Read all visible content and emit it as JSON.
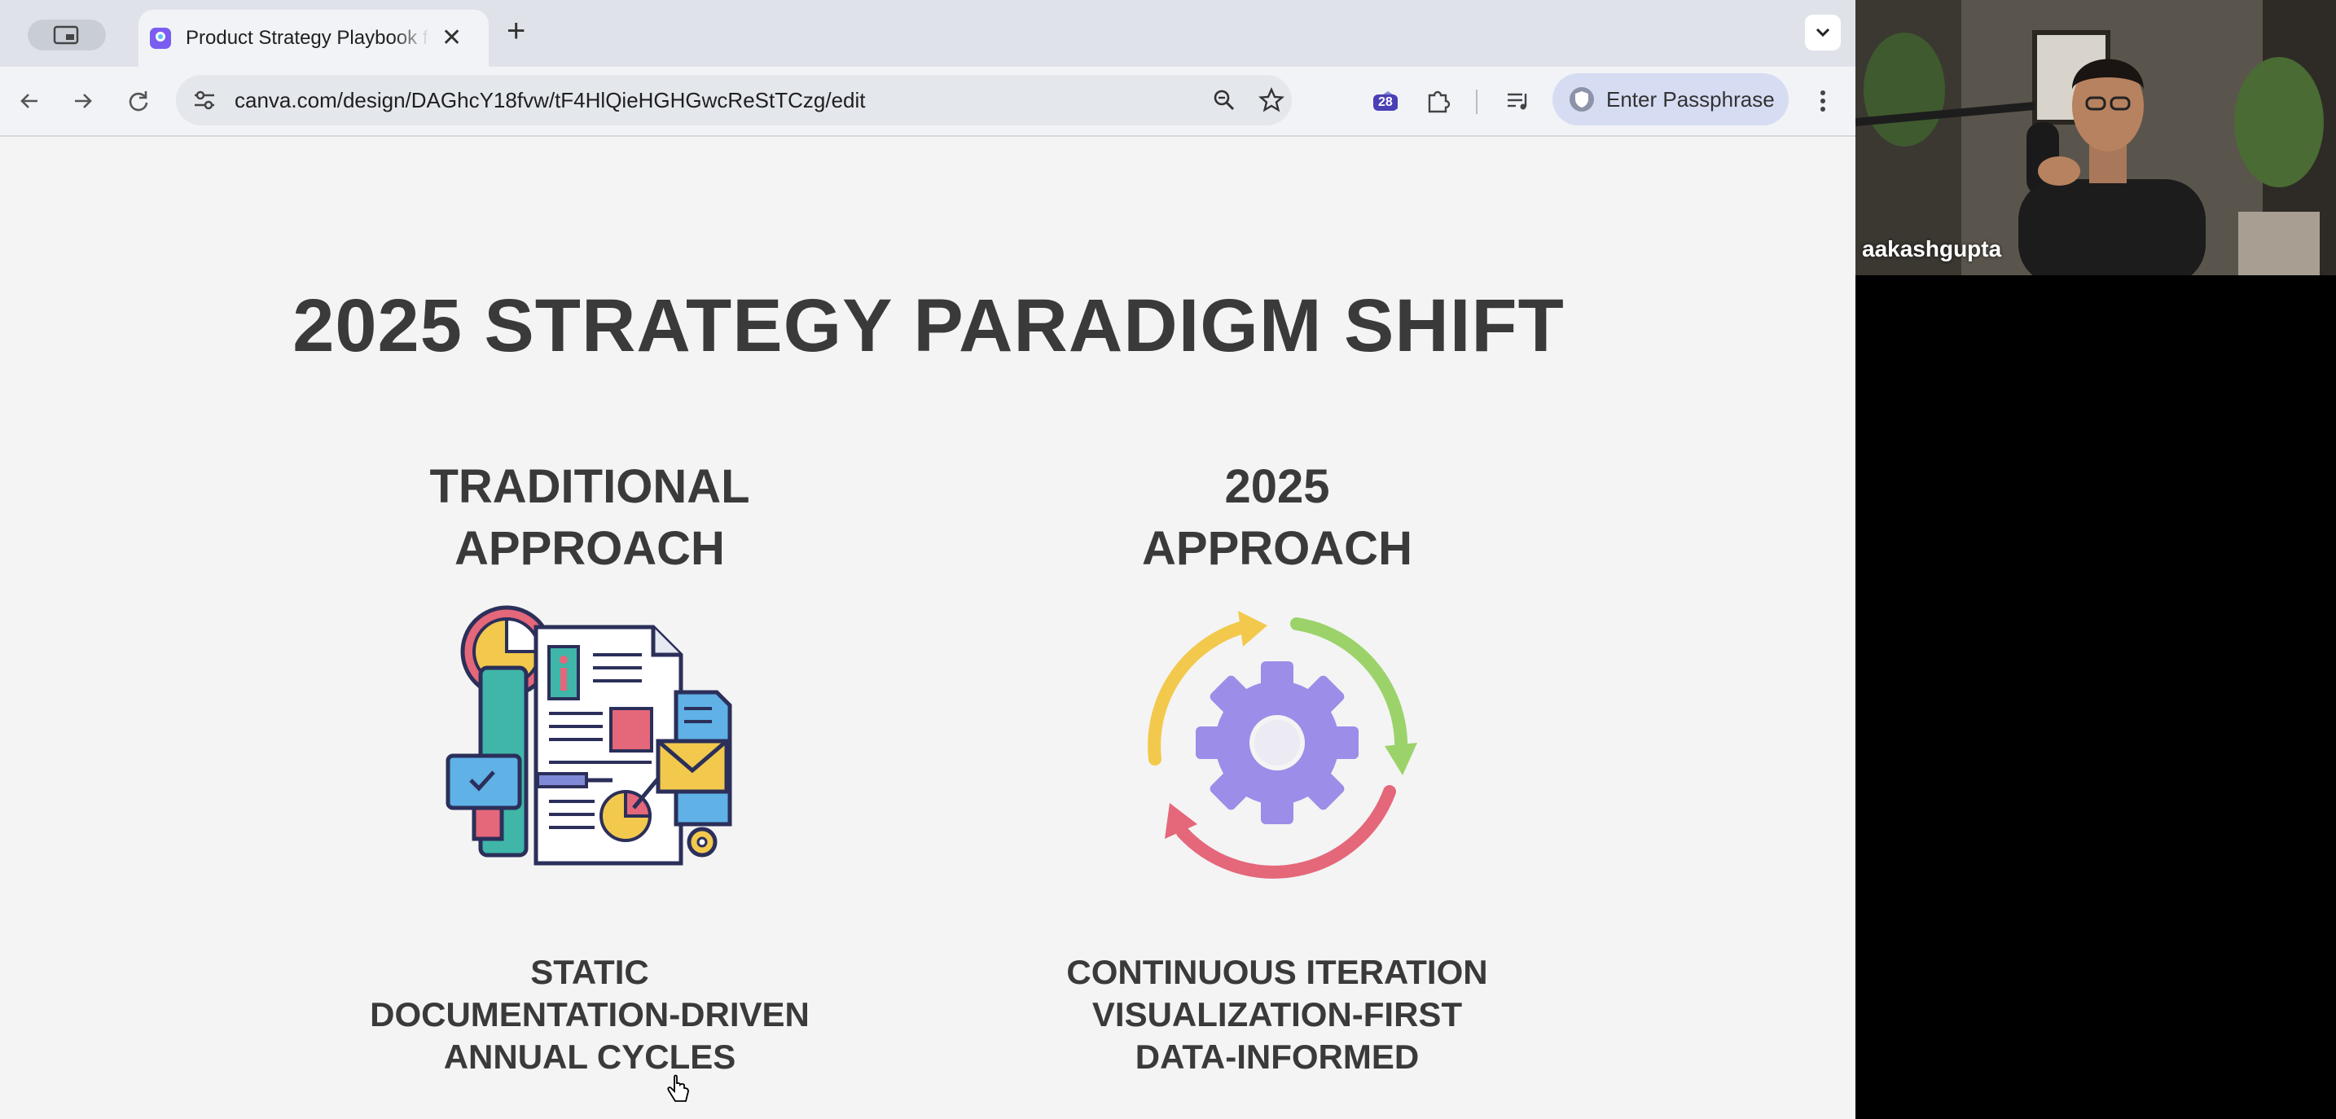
{
  "browser": {
    "tab": {
      "title": "Product Strategy Playbook for",
      "close": "✕"
    },
    "new_tab": "+",
    "url": "canva.com/design/DAGhcY18fvw/tF4HlQieHGHGwcReStTCzg/edit",
    "extension_badge": "28",
    "passphrase_label": "Enter Passphrase"
  },
  "slide": {
    "title": "2025 STRATEGY PARADIGM SHIFT",
    "left": {
      "heading": [
        "TRADITIONAL",
        "APPROACH"
      ],
      "points": [
        "STATIC",
        "DOCUMENTATION-DRIVEN",
        "ANNUAL CYCLES"
      ]
    },
    "right": {
      "heading": [
        "2025",
        "APPROACH"
      ],
      "points": [
        "CONTINUOUS ITERATION",
        "VISUALIZATION-FIRST",
        "DATA-INFORMED"
      ]
    }
  },
  "webcam": {
    "participant_name": "aakashgupta"
  },
  "colors": {
    "title_text": "#3a3a3a",
    "slide_bg": "#f4f4f4",
    "cycle_yellow": "#f2c94c",
    "cycle_green": "#9bd36a",
    "cycle_red": "#e5677a",
    "gear_purple": "#9c8de8"
  },
  "icons": [
    "tab-switcher-icon",
    "canva-favicon",
    "close-icon",
    "plus-icon",
    "chevron-down-icon",
    "back-arrow-icon",
    "forward-arrow-icon",
    "reload-icon",
    "site-settings-icon",
    "zoom-icon",
    "star-icon",
    "extension-icon",
    "puzzle-icon",
    "media-icon",
    "shield-icon",
    "kebab-icon",
    "pointer-cursor-icon"
  ]
}
